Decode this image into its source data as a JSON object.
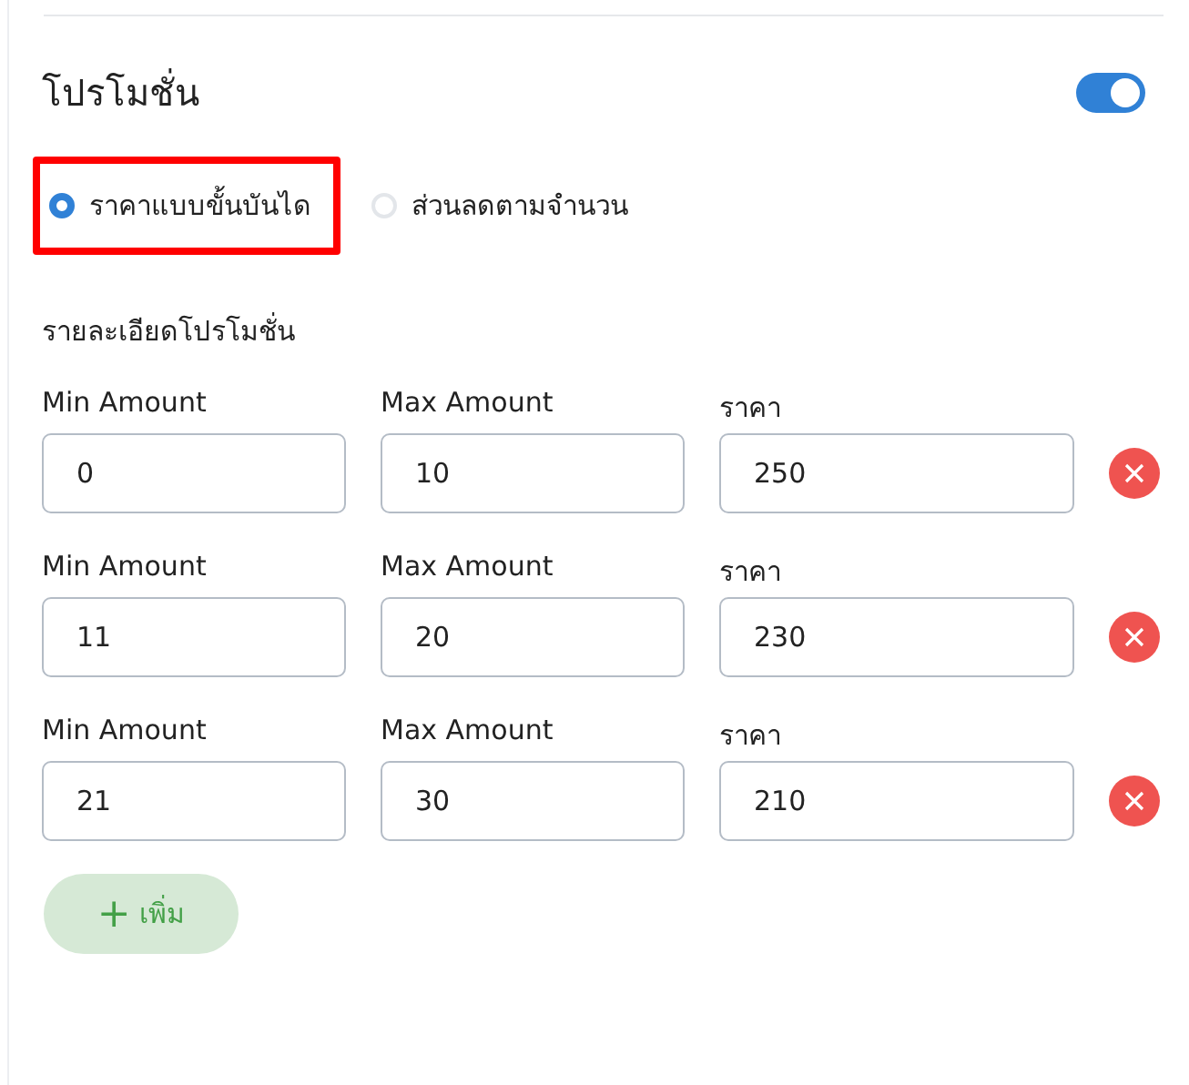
{
  "section": {
    "title": "โปรโมชั่น",
    "toggle": {
      "on": true
    }
  },
  "price_modes": [
    {
      "label": "ราคาแบบขั้นบันได",
      "selected": true,
      "highlighted": true
    },
    {
      "label": "ส่วนลดตามจำนวน",
      "selected": false,
      "highlighted": false
    }
  ],
  "details_title": "รายละเอียดโปรโมชั่น",
  "tiers": [
    {
      "min_label": "Min Amount",
      "min": "0",
      "max_label": "Max Amount",
      "max": "10",
      "price_label": "ราคา",
      "price": "250"
    },
    {
      "min_label": "Min Amount",
      "min": "11",
      "max_label": "Max Amount",
      "max": "20",
      "price_label": "ราคา",
      "price": "230"
    },
    {
      "min_label": "Min Amount",
      "min": "21",
      "max_label": "Max Amount",
      "max": "30",
      "price_label": "ราคา",
      "price": "210"
    }
  ],
  "add_button": {
    "icon": "+",
    "label": "เพิ่ม"
  }
}
